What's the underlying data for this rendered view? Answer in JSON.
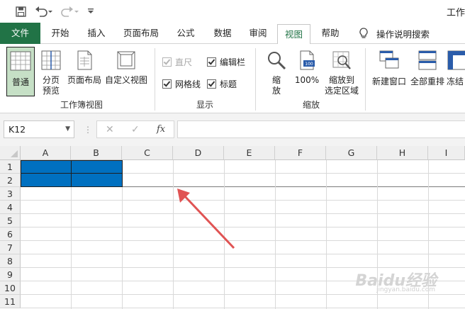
{
  "title_bar": {
    "title": "工作"
  },
  "tabs": [
    "文件",
    "开始",
    "插入",
    "页面布局",
    "公式",
    "数据",
    "审阅",
    "视图",
    "帮助"
  ],
  "active_tab": "视图",
  "tell_me": "操作说明搜索",
  "ribbon": {
    "workbook_views": {
      "normal": "普通",
      "page_break_1": "分页",
      "page_break_2": "预览",
      "page_layout": "页面布局",
      "custom_views": "自定义视图",
      "group_label": "工作簿视图"
    },
    "show": {
      "ruler": "直尺",
      "formula_bar": "编辑栏",
      "gridlines": "网格线",
      "headings": "标题",
      "group_label": "显示"
    },
    "zoom": {
      "zoom_1": "缩",
      "zoom_2": "放",
      "hundred": "100%",
      "zoom_sel_1": "缩放到",
      "zoom_sel_2": "选定区域",
      "group_label": "缩放"
    },
    "window": {
      "new_window": "新建窗口",
      "arrange_all": "全部重排",
      "freeze": "冻结"
    }
  },
  "formula_bar": {
    "name_box": "K12",
    "fx": "fx",
    "value": ""
  },
  "grid": {
    "columns": [
      "A",
      "B",
      "C",
      "D",
      "E",
      "F",
      "G",
      "H",
      "I"
    ],
    "rows": [
      "1",
      "2",
      "3",
      "4",
      "5",
      "6",
      "7",
      "8",
      "9",
      "10",
      "11"
    ]
  },
  "watermark": {
    "text": "Baidu经验",
    "sub": "jingyan.baidu.com"
  },
  "colors": {
    "excel_green": "#217346",
    "selection": "#0070c0",
    "arrow": "#e05353"
  }
}
